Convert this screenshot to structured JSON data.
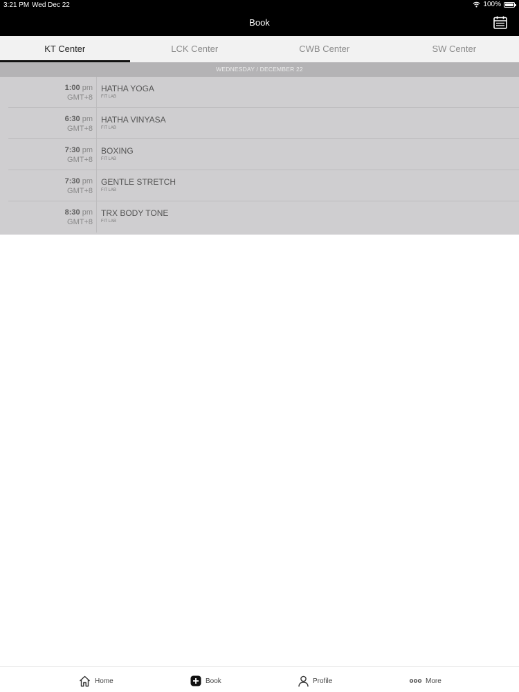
{
  "status_bar": {
    "time": "3:21 PM",
    "date": "Wed Dec 22",
    "battery": "100%"
  },
  "header": {
    "title": "Book"
  },
  "tabs": [
    {
      "label": "KT Center",
      "active": true
    },
    {
      "label": "LCK Center",
      "active": false
    },
    {
      "label": "CWB Center",
      "active": false
    },
    {
      "label": "SW Center",
      "active": false
    }
  ],
  "schedule": {
    "date_header": "WEDNESDAY / DECEMBER 22",
    "classes": [
      {
        "time": "1:00",
        "ampm": "pm",
        "tz": "GMT+8",
        "name": "HATHA YOGA",
        "location": "FIT LAB"
      },
      {
        "time": "6:30",
        "ampm": "pm",
        "tz": "GMT+8",
        "name": "HATHA VINYASA",
        "location": "FIT LAB"
      },
      {
        "time": "7:30",
        "ampm": "pm",
        "tz": "GMT+8",
        "name": "BOXING",
        "location": "FIT LAB"
      },
      {
        "time": "7:30",
        "ampm": "pm",
        "tz": "GMT+8",
        "name": "GENTLE STRETCH",
        "location": "FIT LAB"
      },
      {
        "time": "8:30",
        "ampm": "pm",
        "tz": "GMT+8",
        "name": "TRX BODY TONE",
        "location": "FIT LAB"
      }
    ]
  },
  "bottom_nav": {
    "home": {
      "label": "Home",
      "icon": "home-icon"
    },
    "book": {
      "label": "Book",
      "icon": "plus-square-icon"
    },
    "profile": {
      "label": "Profile",
      "icon": "person-icon"
    },
    "more": {
      "label": "More",
      "icon": "more-dots-icon"
    }
  }
}
